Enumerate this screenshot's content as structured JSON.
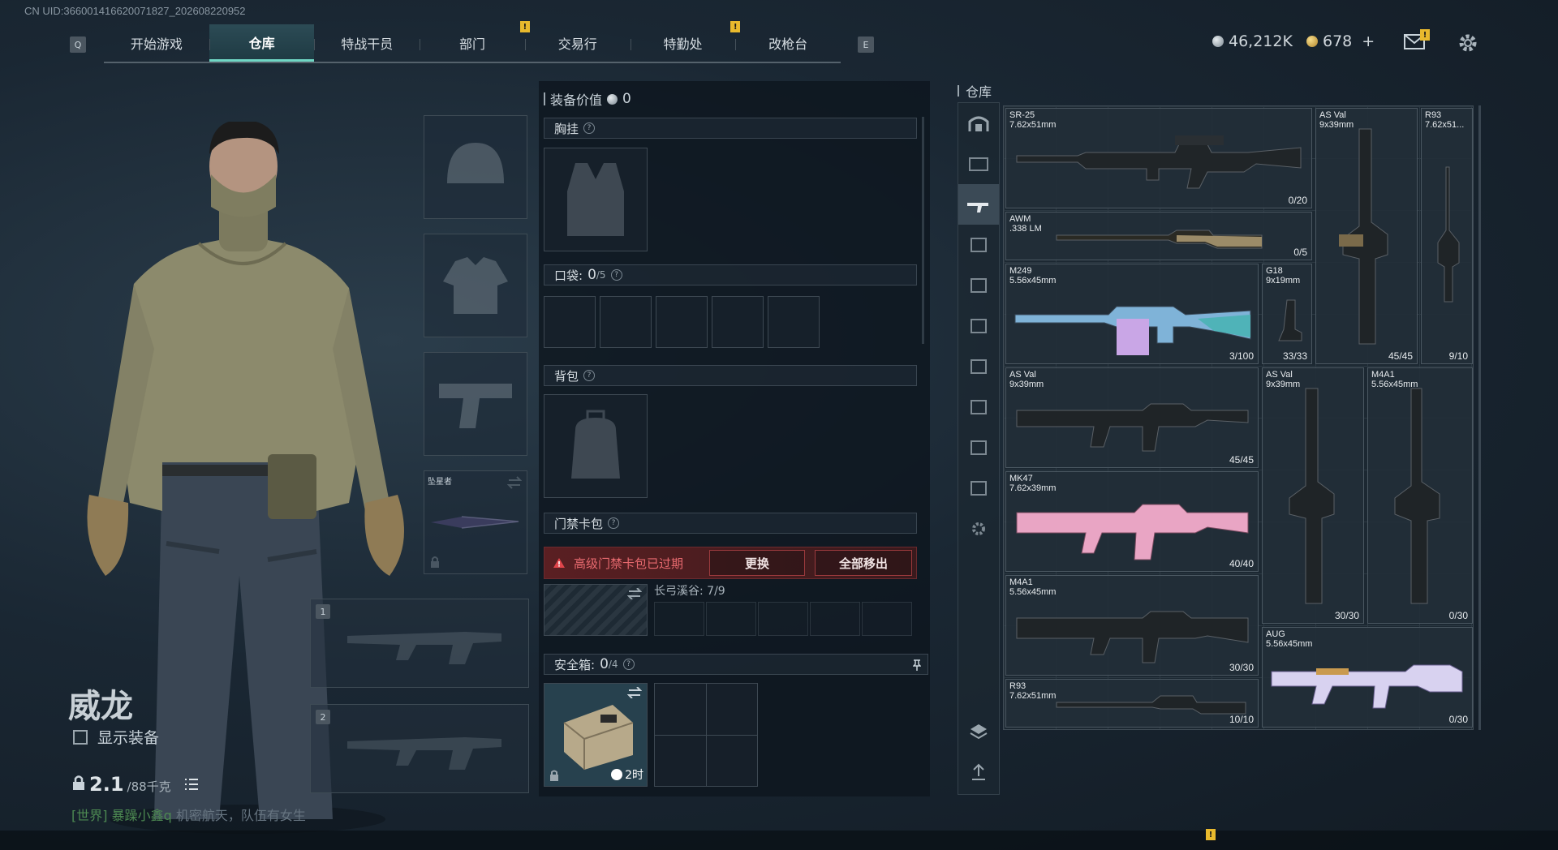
{
  "uid": "CN UID:366001416620071827_202608220952",
  "keys": {
    "left": "Q",
    "right": "E"
  },
  "nav": {
    "tabs": [
      {
        "label": "开始游戏",
        "active": false,
        "alert": false
      },
      {
        "label": "仓库",
        "active": true,
        "alert": false
      },
      {
        "label": "特战干员",
        "active": false,
        "alert": false
      },
      {
        "label": "部门",
        "active": false,
        "alert": true
      },
      {
        "label": "交易行",
        "active": false,
        "alert": false
      },
      {
        "label": "特勤处",
        "active": false,
        "alert": true
      },
      {
        "label": "改枪台",
        "active": false,
        "alert": false
      }
    ]
  },
  "currency": {
    "silver": "46,212K",
    "gold": "678",
    "plus": "+"
  },
  "alert_mark": "!",
  "character": {
    "name": "威龙",
    "show_equipment": "显示装备",
    "weight_value": "2.1",
    "weight_max": "/88千克",
    "melee_label": "坠星者",
    "slot1": "1",
    "slot2": "2"
  },
  "chat": {
    "channel": "[世界]",
    "user": "暴躁小鑫q",
    "message": "机密航天，队伍有女生"
  },
  "middle": {
    "equip_value_label": "装备价值",
    "equip_value": "0",
    "chest_rig": "胸挂",
    "pocket": "口袋:",
    "pocket_count": "0",
    "pocket_max": "/5",
    "backpack": "背包",
    "keycard": "门禁卡包",
    "expired_warning": "高级门禁卡包已过期",
    "replace": "更换",
    "remove_all": "全部移出",
    "map_name": "长弓溪谷: 7/9",
    "safebox": "安全箱:",
    "safebox_count": "0",
    "safebox_max": "/4",
    "timer": "2时"
  },
  "warehouse": {
    "title": "仓库",
    "items": [
      {
        "name": "SR-25\n7.62x51mm",
        "ammo": "0/20"
      },
      {
        "name": "AS Val\n9x39mm",
        "ammo": "45/45"
      },
      {
        "name": "R93\n7.62x51...",
        "ammo": "9/10"
      },
      {
        "name": "AWM\n.338 LM",
        "ammo": "0/5"
      },
      {
        "name": "M249\n5.56x45mm",
        "ammo": "3/100"
      },
      {
        "name": "G18\n9x19mm",
        "ammo": "33/33"
      },
      {
        "name": "AS Val\n9x39mm",
        "ammo": "45/45"
      },
      {
        "name": "AS Val\n9x39mm",
        "ammo": "30/30"
      },
      {
        "name": "M4A1\n5.56x45mm",
        "ammo": "0/30"
      },
      {
        "name": "MK47\n7.62x39mm",
        "ammo": "40/40"
      },
      {
        "name": "M4A1\n5.56x45mm",
        "ammo": "30/30"
      },
      {
        "name": "AUG\n5.56x45mm",
        "ammo": "0/30"
      },
      {
        "name": "R93\n7.62x51mm",
        "ammo": "10/10"
      }
    ]
  },
  "colors": {
    "accent": "#6fd6c4",
    "alert": "#e8b92d",
    "danger": "#e0454b",
    "pink": "#e9a5c4",
    "teal": "#4fb3b8"
  }
}
